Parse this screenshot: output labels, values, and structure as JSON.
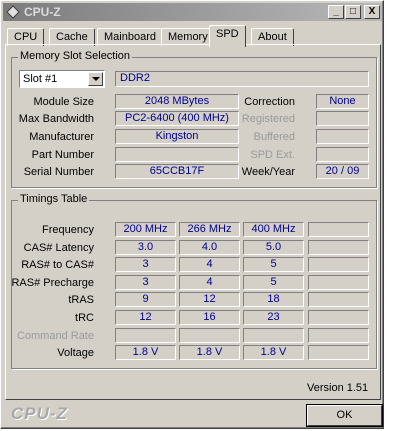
{
  "window": {
    "title": "CPU-Z",
    "app_icon": "cpu-z-app-icon",
    "controls": [
      "_",
      "□",
      "X"
    ]
  },
  "tabs": [
    {
      "label": "CPU",
      "active": false
    },
    {
      "label": "Cache",
      "active": false
    },
    {
      "label": "Mainboard",
      "active": false
    },
    {
      "label": "Memory",
      "active": false
    },
    {
      "label": "SPD",
      "active": true
    },
    {
      "label": "About",
      "active": false
    }
  ],
  "memory_slot": {
    "group_label": "Memory Slot Selection",
    "slot_selected": "Slot #1",
    "memory_type": "DDR2",
    "module_size_label": "Module Size",
    "module_size": "2048 MBytes",
    "max_bandwidth_label": "Max Bandwidth",
    "max_bandwidth": "PC2-6400 (400 MHz)",
    "manufacturer_label": "Manufacturer",
    "manufacturer": "Kingston",
    "part_number_label": "Part Number",
    "part_number": "",
    "serial_number_label": "Serial Number",
    "serial_number": "65CCB17F",
    "correction_label": "Correction",
    "correction": "None",
    "registered_label": "Registered",
    "registered": "",
    "buffered_label": "Buffered",
    "buffered": "",
    "spd_ext_label": "SPD Ext.",
    "spd_ext": "",
    "week_year_label": "Week/Year",
    "week_year": "20 / 09"
  },
  "timings": {
    "group_label": "Timings Table",
    "rows": [
      {
        "label": "Frequency",
        "dim": false,
        "values": [
          "200 MHz",
          "266 MHz",
          "400 MHz",
          ""
        ]
      },
      {
        "label": "CAS# Latency",
        "dim": false,
        "values": [
          "3.0",
          "4.0",
          "5.0",
          ""
        ]
      },
      {
        "label": "RAS# to CAS#",
        "dim": false,
        "values": [
          "3",
          "4",
          "5",
          ""
        ]
      },
      {
        "label": "RAS# Precharge",
        "dim": false,
        "values": [
          "3",
          "4",
          "5",
          ""
        ]
      },
      {
        "label": "tRAS",
        "dim": false,
        "values": [
          "9",
          "12",
          "18",
          ""
        ]
      },
      {
        "label": "tRC",
        "dim": false,
        "values": [
          "12",
          "16",
          "23",
          ""
        ]
      },
      {
        "label": "Command Rate",
        "dim": true,
        "values": [
          "",
          "",
          "",
          ""
        ]
      },
      {
        "label": "Voltage",
        "dim": false,
        "values": [
          "1.8 V",
          "1.8 V",
          "1.8 V",
          ""
        ]
      }
    ]
  },
  "footer": {
    "version": "Version 1.51",
    "logo": "CPU-Z",
    "ok_label": "OK"
  }
}
